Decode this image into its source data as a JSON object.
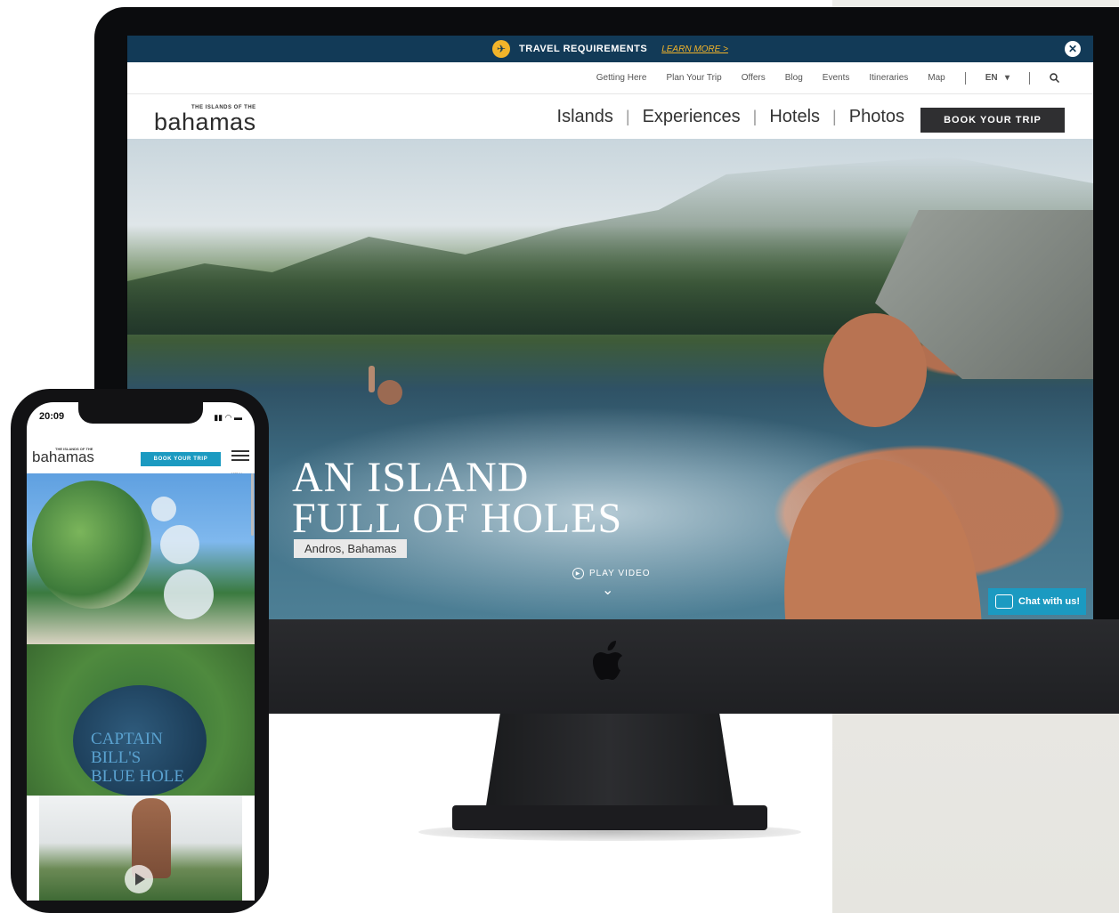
{
  "desktop": {
    "alert": {
      "label": "TRAVEL REQUIREMENTS",
      "link": "LEARN MORE >",
      "close_icon": "close-icon"
    },
    "utility_nav": [
      "Getting Here",
      "Plan Your Trip",
      "Offers",
      "Blog",
      "Events",
      "Itineraries",
      "Map"
    ],
    "language": "EN",
    "logo": {
      "small_text": "THE ISLANDS OF THE",
      "big_text": "bahamas"
    },
    "main_nav": [
      "Islands",
      "Experiences",
      "Hotels",
      "Photos"
    ],
    "book_button": "BOOK YOUR TRIP",
    "hero": {
      "headline_line1": "AN ISLAND",
      "headline_line2": "FULL OF HOLES",
      "location": "Andros, Bahamas",
      "play_label": "PLAY VIDEO"
    },
    "chat_button": "Chat with us!"
  },
  "mobile": {
    "time": "20:09",
    "logo": {
      "small_text": "THE ISLANDS OF THE",
      "big_text": "bahamas"
    },
    "book_button": "BOOK YOUR TRIP",
    "menu_label": "MENU",
    "feature_title_line1": "CAPTAIN",
    "feature_title_line2": "BILL'S",
    "feature_title_line3": "BLUE HOLE"
  },
  "colors": {
    "alert_bar": "#123a57",
    "accent_yellow": "#f2b42a",
    "book_button_dark": "#2f2f31",
    "chat_blue": "#1b9ac1",
    "monitor_bezel": "#0b0c0e"
  }
}
